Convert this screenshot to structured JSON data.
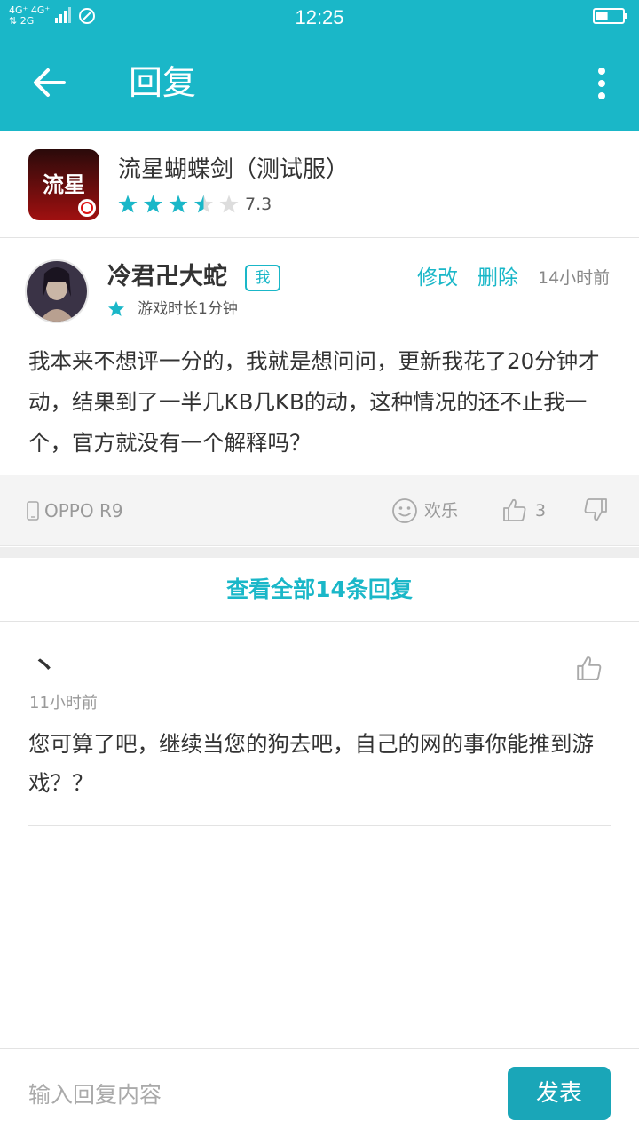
{
  "status_bar": {
    "time": "12:25",
    "network_top": "4G⁺ 4G⁺",
    "network_bottom": "⇅ 2G",
    "battery_level": 0.45
  },
  "app_bar": {
    "title": "回复"
  },
  "game": {
    "name": "流星蝴蝶剑（测试服）",
    "icon_text": "流星",
    "rating": 3.5,
    "score": "7.3"
  },
  "comment": {
    "username": "冷君卍大蛇",
    "badge": "我",
    "edit_label": "修改",
    "delete_label": "删除",
    "time": "14小时前",
    "playtime": "游戏时长1分钟",
    "text": "我本来不想评一分的，我就是想问问，更新我花了20分钟才动，结果到了一半几KB几KB的动，这种情况的还不止我一个，官方就没有一个解释吗？",
    "device": "OPPO R9",
    "mood": "欢乐",
    "likes": "3"
  },
  "view_all": "查看全部14条回复",
  "reply": {
    "username": "丶",
    "time": "11小时前",
    "text": "您可算了吧，继续当您的狗去吧，自己的网的事你能推到游戏？？"
  },
  "input": {
    "placeholder": "输入回复内容",
    "send_label": "发表"
  },
  "colors": {
    "accent": "#1ab7c8",
    "send_button": "#1aa6b8"
  }
}
